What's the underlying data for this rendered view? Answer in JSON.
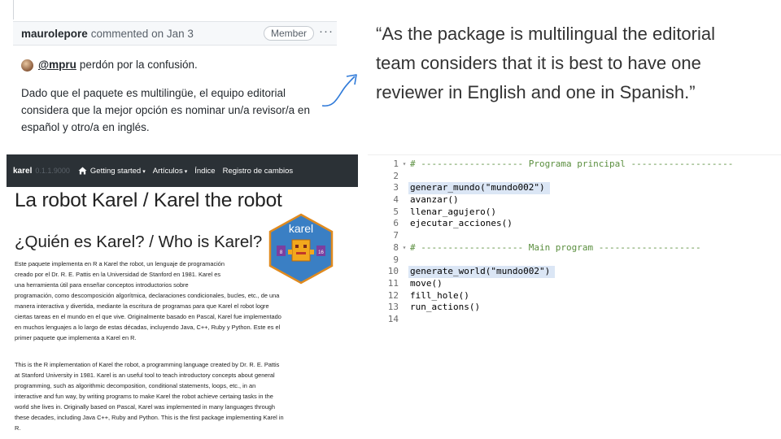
{
  "comment": {
    "author": "maurolepore",
    "action": "commented on Jan 3",
    "badge": "Member",
    "more": "···",
    "mention": "@mpru",
    "mention_text": "perdón por la confusión.",
    "body": [
      "Dado que el paquete es multilingüe, el equipo editorial",
      "considera que la mejor opción es nominar un/a revisor/a en",
      "español y otro/a en inglés."
    ]
  },
  "quote": {
    "lines": [
      "“As the package is multilingual the editorial",
      "team considers that it is best to have one",
      "reviewer in English and one in Spanish.”"
    ]
  },
  "site": {
    "brand": "karel",
    "version": "0.1.1.9000",
    "nav": [
      "Getting started",
      "Artículos",
      "Índice",
      "Registro de cambios"
    ],
    "title": "La robot Karel / Karel the robot",
    "heading": "¿Quién es Karel? / Who is Karel?",
    "logo_text": "karel",
    "logo_left": "8",
    "logo_right": "16",
    "p1": [
      "Este paquete implementa en R a Karel the robot, un lenguaje de programación",
      "creado por el Dr. R. E. Pattis en la Universidad de Stanford en 1981. Karel es",
      "una herramienta útil para enseñar conceptos introductorios sobre",
      "programación, como descomposición algorítmica, declaraciones condicionales, bucles, etc., de una",
      "manera interactiva y divertida, mediante la escritura de programas para que Karel el robot logre",
      "ciertas tareas en el mundo en el que vive. Originalmente basado en Pascal, Karel fue implementado",
      "en muchos lenguajes a lo largo de estas décadas, incluyendo Java, C++, Ruby y Python. Este es el",
      "primer paquete que implementa a Karel en R."
    ],
    "p2": [
      "This is the R implementation of Karel the robot, a programming language created by Dr. R. E. Pattis",
      "at Stanford University in 1981. Karel is an useful tool to teach introductory concepts about general",
      "programming, such as algorithmic decomposition, conditional statements, loops, etc., in an",
      "interactive and fun way, by writing programs to make Karel the robot achieve certaing tasks in the",
      "world she lives in. Originally based on Pascal, Karel was implemented in many languages through",
      "these decades, including Java C++, Ruby and Python. This is the first package implementing Karel in",
      "R."
    ]
  },
  "code": {
    "lines": [
      {
        "n": "1",
        "fold": "▾",
        "text": "# ------------------- Programa principal -------------------",
        "kind": "comment",
        "hl": false
      },
      {
        "n": "2",
        "fold": "",
        "text": "",
        "kind": "plain",
        "hl": false
      },
      {
        "n": "3",
        "fold": "",
        "text": "generar_mundo(\"mundo002\")",
        "kind": "plain",
        "hl": true
      },
      {
        "n": "4",
        "fold": "",
        "text": "avanzar()",
        "kind": "plain",
        "hl": false
      },
      {
        "n": "5",
        "fold": "",
        "text": "llenar_agujero()",
        "kind": "plain",
        "hl": false
      },
      {
        "n": "6",
        "fold": "",
        "text": "ejecutar_acciones()",
        "kind": "plain",
        "hl": false
      },
      {
        "n": "7",
        "fold": "",
        "text": "",
        "kind": "plain",
        "hl": false
      },
      {
        "n": "8",
        "fold": "▾",
        "text": "# ------------------- Main program -------------------",
        "kind": "comment",
        "hl": false
      },
      {
        "n": "9",
        "fold": "",
        "text": "",
        "kind": "plain",
        "hl": false
      },
      {
        "n": "10",
        "fold": "",
        "text": "generate_world(\"mundo002\")",
        "kind": "plain",
        "hl": true
      },
      {
        "n": "11",
        "fold": "",
        "text": "move()",
        "kind": "plain",
        "hl": false
      },
      {
        "n": "12",
        "fold": "",
        "text": "fill_hole()",
        "kind": "plain",
        "hl": false
      },
      {
        "n": "13",
        "fold": "",
        "text": "run_actions()",
        "kind": "plain",
        "hl": false
      },
      {
        "n": "14",
        "fold": "",
        "text": "",
        "kind": "plain",
        "hl": false
      }
    ]
  },
  "colors": {
    "navbar": "#2b3136",
    "logo_hex": "#3a7fc4",
    "logo_face": "#f2a81d",
    "logo_side": "#7b3fa0",
    "highlight": "#dbe6f5",
    "arrow": "#2f7ad9"
  }
}
